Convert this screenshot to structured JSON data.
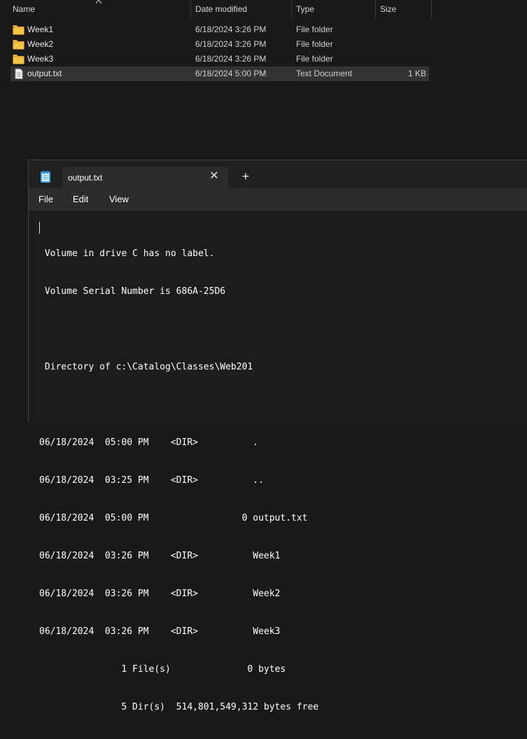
{
  "explorer": {
    "columns": {
      "name": "Name",
      "date": "Date modified",
      "type": "Type",
      "size": "Size"
    },
    "files": [
      {
        "name": "Week1",
        "date": "6/18/2024 3:26 PM",
        "type": "File folder",
        "size": "",
        "icon": "folder-icon",
        "selected": false
      },
      {
        "name": "Week2",
        "date": "6/18/2024 3:26 PM",
        "type": "File folder",
        "size": "",
        "icon": "folder-icon",
        "selected": false
      },
      {
        "name": "Week3",
        "date": "6/18/2024 3:26 PM",
        "type": "File folder",
        "size": "",
        "icon": "folder-icon",
        "selected": false
      },
      {
        "name": "output.txt",
        "date": "6/18/2024 5:00 PM",
        "type": "Text Document",
        "size": "1 KB",
        "icon": "text-file-icon",
        "selected": true
      }
    ]
  },
  "notepad": {
    "tab_title": "output.txt",
    "close_glyph": "✕",
    "new_tab_glyph": "+",
    "menu": {
      "file": "File",
      "edit": "Edit",
      "view": "View"
    },
    "content_lines": [
      " Volume in drive C has no label.",
      " Volume Serial Number is 686A-25D6",
      "",
      " Directory of c:\\Catalog\\Classes\\Web201",
      "",
      "06/18/2024  05:00 PM    <DIR>          .",
      "06/18/2024  03:25 PM    <DIR>          ..",
      "06/18/2024  05:00 PM                 0 output.txt",
      "06/18/2024  03:26 PM    <DIR>          Week1",
      "06/18/2024  03:26 PM    <DIR>          Week2",
      "06/18/2024  03:26 PM    <DIR>          Week3",
      "               1 File(s)              0 bytes",
      "               5 Dir(s)  514,801,549,312 bytes free"
    ]
  },
  "colors": {
    "folder": "#f4c542",
    "background": "#191919",
    "selected_row": "#333333"
  }
}
